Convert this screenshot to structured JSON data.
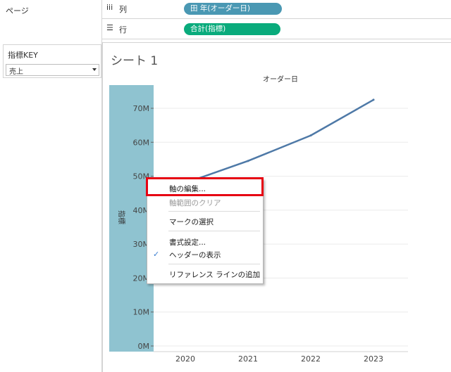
{
  "pages": {
    "label": "ページ"
  },
  "filter": {
    "title": "指標KEY",
    "value": "売上"
  },
  "columns": {
    "icon": "iii",
    "label": "列",
    "pill": "田 年(オーダー日)",
    "pill_color": "#4a98b3"
  },
  "rows": {
    "icon": "☰",
    "label": "行",
    "pill": "合計(指標)",
    "pill_color": "#0aab7c"
  },
  "sheet": {
    "title": "シート 1"
  },
  "chart_data": {
    "type": "line",
    "title": "オーダー日",
    "ylabel": "指標",
    "y_ticks": [
      "0M",
      "10M",
      "20M",
      "30M",
      "40M",
      "50M",
      "60M",
      "70M"
    ],
    "ylim": [
      0,
      75000000
    ],
    "x": [
      "2020",
      "2021",
      "2022",
      "2023"
    ],
    "series": [
      {
        "values": [
          48000000,
          54500000,
          62000000,
          72500000
        ],
        "color": "#4e79a7"
      }
    ],
    "grid": true
  },
  "context_menu": {
    "items": [
      {
        "label": "軸の編集...",
        "enabled": true,
        "checked": false
      },
      {
        "label": "軸範囲のクリア",
        "enabled": false,
        "checked": false
      },
      {
        "label": "マークの選択",
        "enabled": true,
        "checked": false
      },
      {
        "label": "書式設定...",
        "enabled": true,
        "checked": false
      },
      {
        "label": "ヘッダーの表示",
        "enabled": true,
        "checked": true
      },
      {
        "label": "リファレンス ラインの追加",
        "enabled": true,
        "checked": false
      }
    ],
    "highlight_color": "#e60012"
  }
}
